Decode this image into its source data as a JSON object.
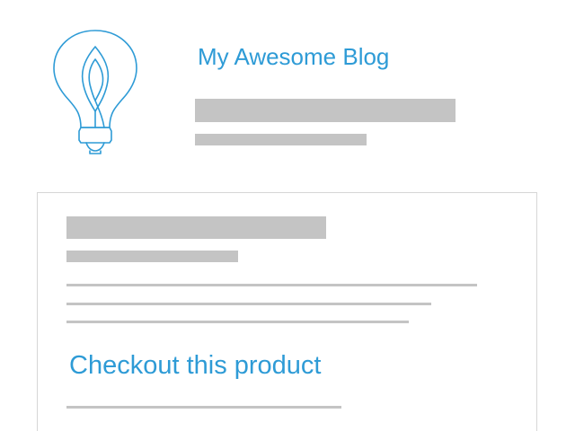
{
  "header": {
    "title": "My Awesome Blog",
    "logo_icon": "lightbulb-leaf-icon"
  },
  "post": {
    "link_text": "Checkout this product"
  },
  "colors": {
    "accent": "#2e9bd6",
    "placeholder": "#c4c4c4",
    "card_border": "#d6d6d6"
  }
}
